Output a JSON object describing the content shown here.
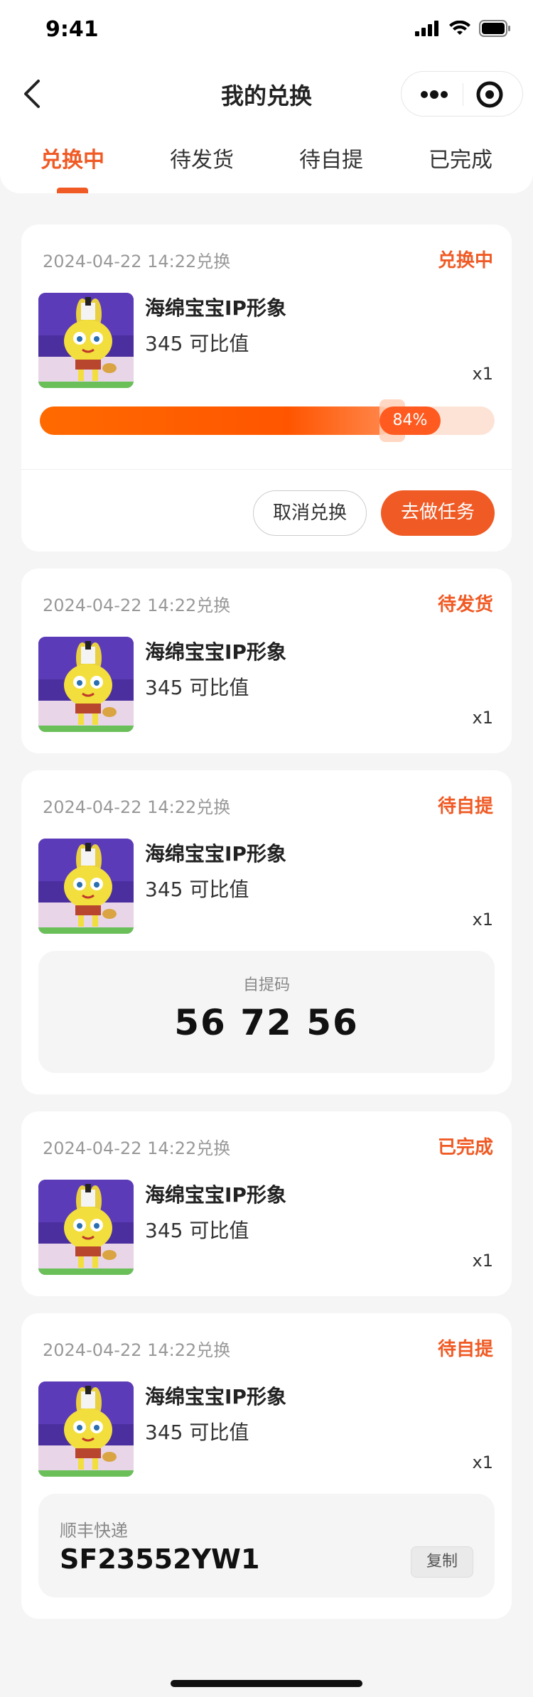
{
  "status_bar": {
    "time": "9:41"
  },
  "nav": {
    "title": "我的兑换"
  },
  "tabs": [
    {
      "label": "兑换中",
      "active": true
    },
    {
      "label": "待发货",
      "active": false
    },
    {
      "label": "待自提",
      "active": false
    },
    {
      "label": "已完成",
      "active": false
    }
  ],
  "colors": {
    "accent": "#f05a24",
    "background": "#f5f5f5"
  },
  "orders": [
    {
      "date": "2024-04-22 14:22兑换",
      "status": "兑换中",
      "product_name": "海绵宝宝IP形象",
      "value": "345 可比值",
      "qty": "x1",
      "progress_label": "84%",
      "progress": 0.84,
      "cancel_label": "取消兑换",
      "task_label": "去做任务"
    },
    {
      "date": "2024-04-22 14:22兑换",
      "status": "待发货",
      "product_name": "海绵宝宝IP形象",
      "value": "345 可比值",
      "qty": "x1"
    },
    {
      "date": "2024-04-22 14:22兑换",
      "status": "待自提",
      "product_name": "海绵宝宝IP形象",
      "value": "345 可比值",
      "qty": "x1",
      "pickup_label": "自提码",
      "pickup_code": "56 72 56"
    },
    {
      "date": "2024-04-22 14:22兑换",
      "status": "已完成",
      "product_name": "海绵宝宝IP形象",
      "value": "345 可比值",
      "qty": "x1"
    },
    {
      "date": "2024-04-22 14:22兑换",
      "status": "待自提",
      "product_name": "海绵宝宝IP形象",
      "value": "345 可比值",
      "qty": "x1",
      "express_company": "顺丰快递",
      "tracking_no": "SF23552YW1",
      "copy_label": "复制"
    }
  ]
}
